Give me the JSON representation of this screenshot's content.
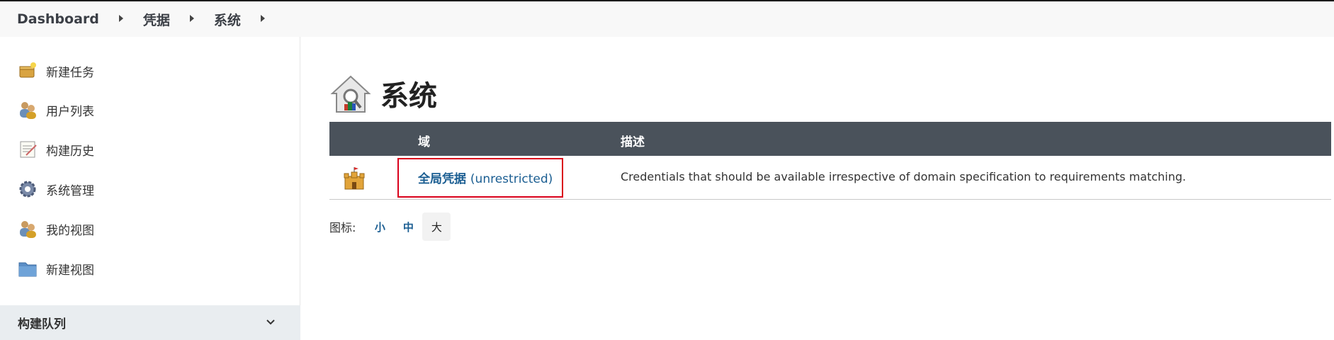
{
  "breadcrumb": {
    "items": [
      "Dashboard",
      "凭据",
      "系统"
    ]
  },
  "sidebar": {
    "items": [
      {
        "label": "新建任务",
        "icon": "new-item-icon"
      },
      {
        "label": "用户列表",
        "icon": "users-icon"
      },
      {
        "label": "构建历史",
        "icon": "notepad-icon"
      },
      {
        "label": "系统管理",
        "icon": "gear-icon"
      },
      {
        "label": "我的视图",
        "icon": "users-icon"
      },
      {
        "label": "新建视图",
        "icon": "folder-icon"
      }
    ],
    "queue_label": "构建队列"
  },
  "main": {
    "title": "系统",
    "table": {
      "headers": [
        "域",
        "描述"
      ],
      "rows": [
        {
          "domain_main": "全局凭据",
          "domain_suffix": "(unrestricted)",
          "description": "Credentials that should be available irrespective of domain specification to requirements matching."
        }
      ]
    },
    "icon_size": {
      "label": "图标:",
      "options": [
        "小",
        "中",
        "大"
      ],
      "selected": "大"
    }
  },
  "colors": {
    "header_bg": "#4a525b",
    "link": "#1b5e92",
    "highlight": "#d9001b"
  }
}
